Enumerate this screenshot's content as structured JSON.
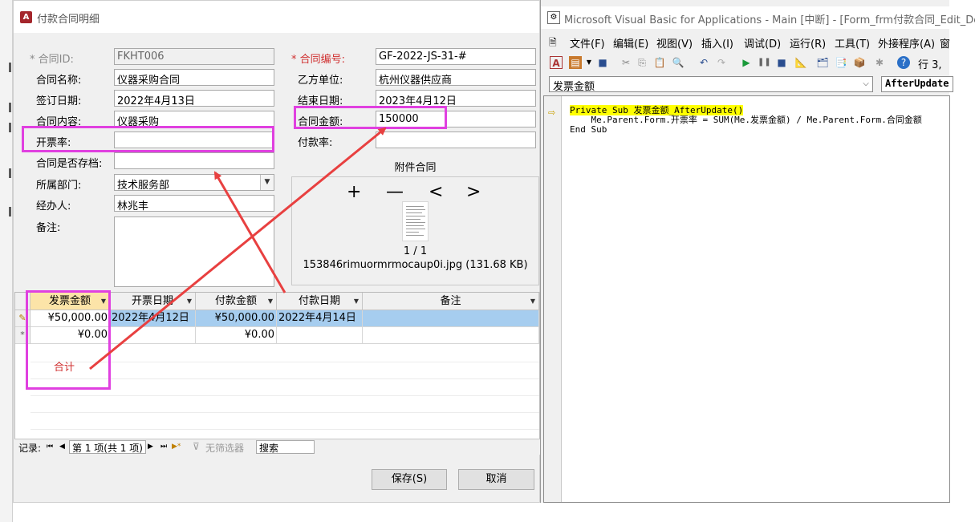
{
  "access": {
    "title": "付款合同明细",
    "fields": {
      "contract_id_label": "* 合同ID:",
      "contract_id_value": "FKHT006",
      "contract_name_label": "合同名称:",
      "contract_name_value": "仪器采购合同",
      "sign_date_label": "签订日期:",
      "sign_date_value": "2022年4月13日",
      "content_label": "合同内容:",
      "content_value": "仪器采购",
      "invoice_rate_label": "开票率:",
      "invoice_rate_value": "",
      "archived_label": "合同是否存档:",
      "archived_value": "",
      "dept_label": "所属部门:",
      "dept_value": "技术服务部",
      "handler_label": "经办人:",
      "handler_value": "林兆丰",
      "remark_label": "备注:",
      "remark_value": "",
      "contract_no_label": "* 合同编号:",
      "contract_no_value": "GF-2022-JS-31-#",
      "party_b_label": "乙方单位:",
      "party_b_value": "杭州仪器供应商",
      "end_date_label": "结束日期:",
      "end_date_value": "2023年4月12日",
      "amount_label": "合同金额:",
      "amount_value": "150000",
      "pay_rate_label": "付款率:",
      "pay_rate_value": ""
    },
    "attachment": {
      "title": "附件合同",
      "add": "+",
      "remove": "—",
      "prev": "<",
      "next": ">",
      "page": "1 / 1",
      "filename": "153846rimuormrmocaup0i.jpg (131.68 KB)"
    },
    "grid": {
      "headers": [
        "发票金额",
        "开票日期",
        "付款金额",
        "付款日期",
        "备注"
      ],
      "row1": [
        "¥50,000.00",
        "2022年4月12日",
        "¥50,000.00",
        "2022年4月14日",
        ""
      ],
      "row_new": [
        "¥0.00",
        "",
        "¥0.00",
        "",
        ""
      ],
      "row1_selector": "✎",
      "new_selector": "*",
      "sum_label": "合计"
    },
    "nav": {
      "record_label": "记录:",
      "first": "⏮",
      "prev": "◀",
      "position": "第 1 项(共 1 项)",
      "next": "▶",
      "last": "⏭",
      "new": "▶*",
      "filter": "无筛选器",
      "search": "搜索"
    },
    "buttons": {
      "save": "保存(S)",
      "cancel": "取消"
    }
  },
  "vba": {
    "title": "Microsoft Visual Basic for Applications - Main [中断] - [Form_frm付款合同_Edit_Deta",
    "menu": [
      "文件(F)",
      "编辑(E)",
      "视图(V)",
      "插入(I)",
      "调试(D)",
      "运行(R)",
      "工具(T)",
      "外接程序(A)",
      "窗"
    ],
    "status": "行 3,",
    "object_combo": "发票金额",
    "proc_combo": "AfterUpdate",
    "code": {
      "line1": "Private Sub 发票金额_AfterUpdate()",
      "line2": "    Me.Parent.Form.开票率 = SUM(Me.发票金额) / Me.Parent.Form.合同金额",
      "line3": "End Sub"
    }
  },
  "colors": {
    "highlight": "#e040e0",
    "arrow": "#e84040",
    "selected_row": "#a6cdef",
    "debug_line": "#ffff00"
  }
}
